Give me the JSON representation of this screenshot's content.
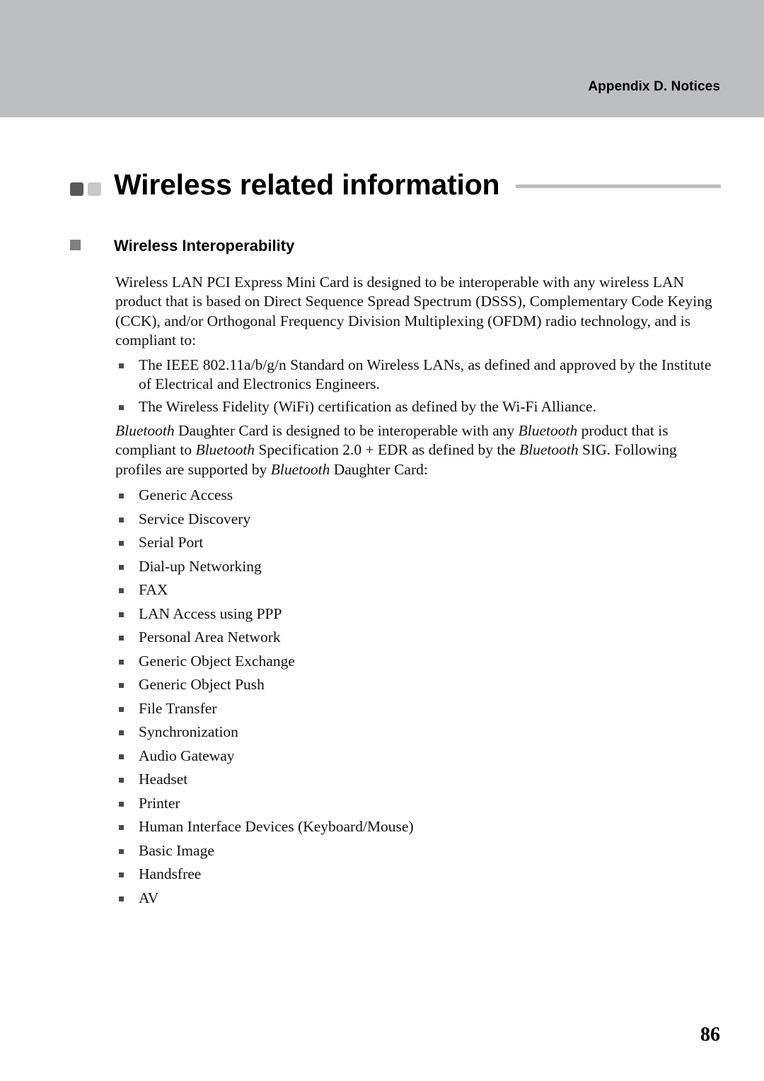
{
  "header": {
    "running_head": "Appendix D. Notices",
    "band_color": "#bcbec0"
  },
  "title": {
    "text": "Wireless related information",
    "square_dark_color": "#58595b",
    "square_light_color": "#c7c8ca",
    "rule_color": "#bcbec0"
  },
  "section": {
    "heading": "Wireless Interoperability",
    "bullet_color": "#808080",
    "intro_paragraph": "Wireless LAN PCI Express Mini Card is designed to be interoperable with any wireless LAN product that is based on Direct Sequence Spread Spectrum (DSSS), Complementary Code Keying (CCK), and/or Orthogonal Frequency Division Multiplexing (OFDM) radio technology, and is compliant to:",
    "standards_list": [
      "The IEEE 802.11a/b/g/n Standard on Wireless LANs, as defined and approved by the Institute of Electrical and Electronics Engineers.",
      "The Wireless Fidelity (WiFi) certification as defined by the Wi-Fi Alliance."
    ],
    "bluetooth_paragraph": {
      "part1_italic": "Bluetooth",
      "part2": " Daughter Card is designed to be interoperable with any ",
      "part3_italic": "Bluetooth",
      "part4": " product that is compliant to ",
      "part5_italic": "Bluetooth",
      "part6": " Specification 2.0 + EDR as defined by the ",
      "part7_italic": "Bluetooth",
      "part8": " SIG. Following profiles are supported by ",
      "part9_italic": "Bluetooth",
      "part10": " Daughter Card:"
    },
    "profiles_list": [
      "Generic Access",
      "Service Discovery",
      "Serial Port",
      "Dial-up Networking",
      "FAX",
      "LAN Access using PPP",
      "Personal Area Network",
      "Generic Object Exchange",
      "Generic Object Push",
      "File Transfer",
      "Synchronization",
      "Audio Gateway",
      "Headset",
      "Printer",
      "Human Interface Devices (Keyboard/Mouse)",
      "Basic Image",
      "Handsfree",
      "AV"
    ]
  },
  "footer": {
    "page_number": "86"
  }
}
